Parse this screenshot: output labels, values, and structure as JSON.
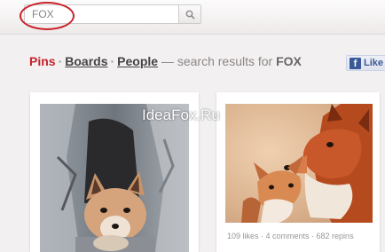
{
  "search": {
    "value": "FOX",
    "button_icon": "search-icon"
  },
  "results": {
    "pins_label": "Pins",
    "boards_label": "Boards",
    "people_label": "People",
    "separator": "·",
    "prefix_text": "— search results for",
    "query": "FOX"
  },
  "facebook": {
    "button_icon": "facebook-icon",
    "label": "Like"
  },
  "watermark": "IdeaFox.Ru",
  "pins": [
    {
      "image": "fox-kit-in-tree-trunk-photo"
    },
    {
      "image": "two-foxes-nuzzling-photo",
      "stats": "109 likes  ·  4 comments  ·  682 repins"
    }
  ],
  "colors": {
    "brand_red": "#c8232c",
    "facebook_blue": "#3b5998"
  }
}
